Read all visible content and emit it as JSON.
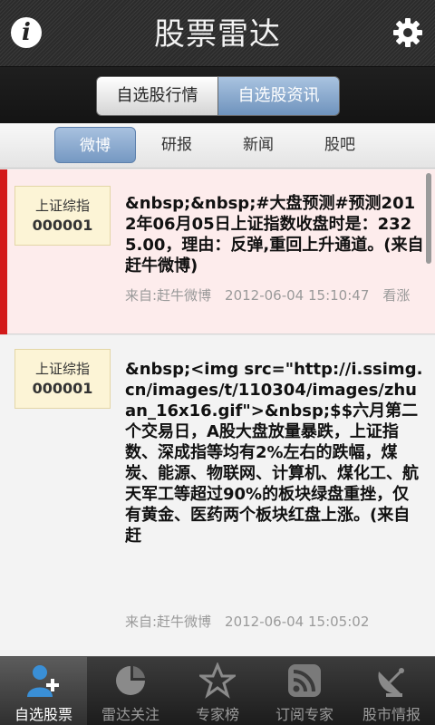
{
  "header": {
    "title": "股票雷达",
    "info_icon": "i"
  },
  "segments": [
    "自选股行情",
    "自选股资讯"
  ],
  "subtabs": [
    "微博",
    "研报",
    "新闻",
    "股吧"
  ],
  "items": [
    {
      "stock_name": "上证综指",
      "stock_code": "000001",
      "text": "&nbsp;&nbsp;#大盘预测#预测2012年06月05日上证指数收盘时是：2325.00，理由：反弹,重回上升通道。(来自赶牛微博)",
      "meta": "来自:赶牛微博　2012-06-04 15:10:47　看涨"
    },
    {
      "stock_name": "上证综指",
      "stock_code": "000001",
      "text": "&nbsp;<img src=\"http://i.ssimg.cn/images/t/110304/images/zhuan_16x16.gif\">&nbsp;$$六月第二个交易日，A股大盘放量暴跌，上证指数、深成指等均有2%左右的跌幅，煤炭、能源、物联网、计算机、煤化工、航天军工等超过90%的板块绿盘重挫，仅有黄金、医药两个板块红盘上涨。(来自赶",
      "meta": "来自:赶牛微博　2012-06-04 15:05:02"
    }
  ],
  "bottom_nav": [
    "自选股票",
    "雷达关注",
    "专家榜",
    "订阅专家",
    "股市情报"
  ],
  "colors": {
    "accent_blue": "#7598c2",
    "highlight_red": "#d31a1a",
    "badge_bg": "#fcf4d6"
  }
}
